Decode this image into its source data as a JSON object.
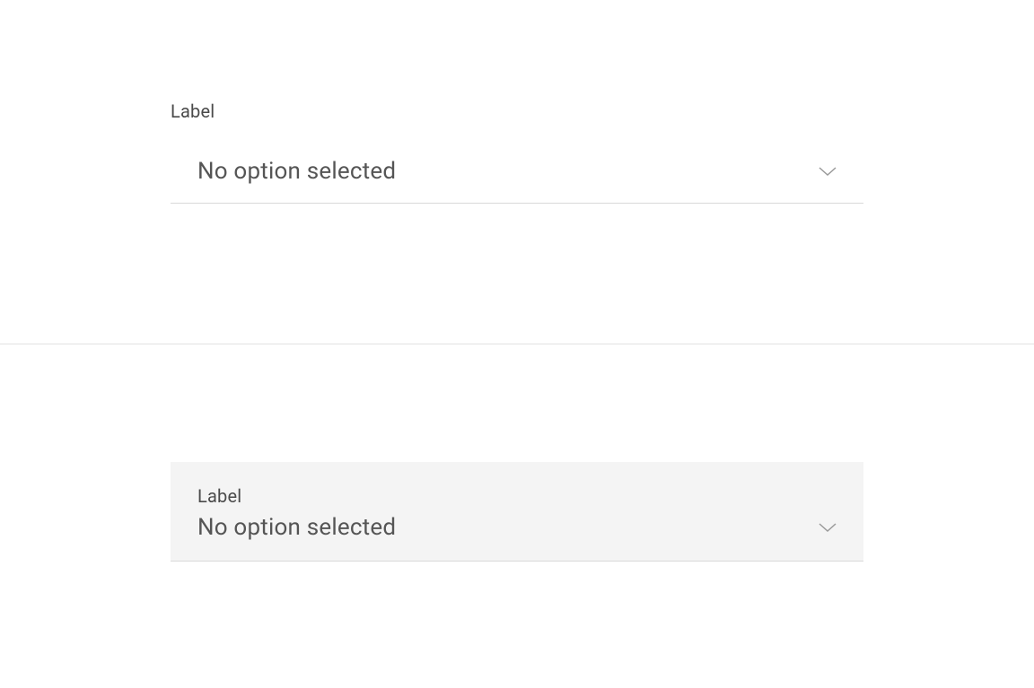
{
  "dropdown1": {
    "label": "Label",
    "value": "No option selected"
  },
  "dropdown2": {
    "label": "Label",
    "value": "No option selected"
  }
}
